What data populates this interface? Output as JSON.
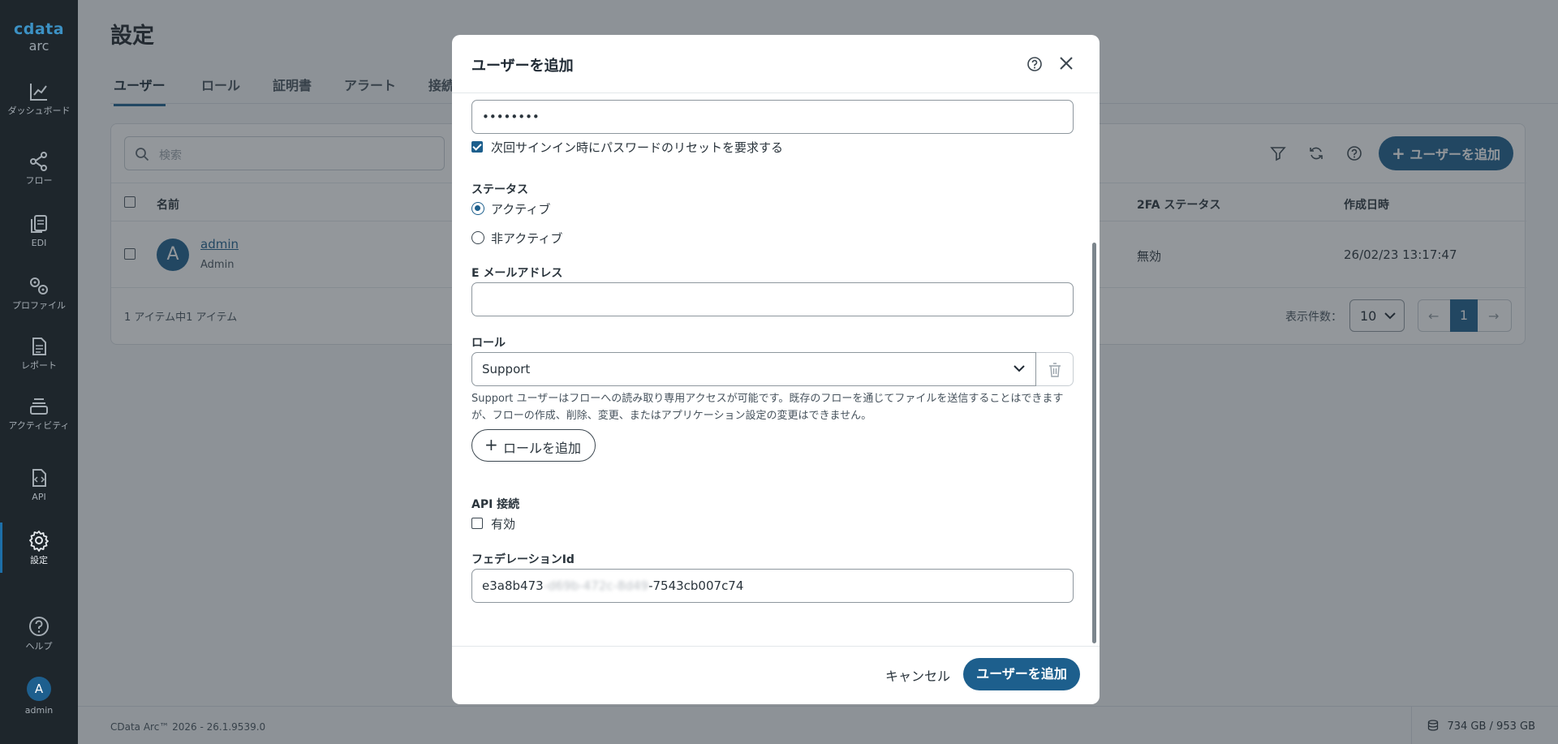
{
  "sidebar": {
    "logo_top": "cdata",
    "logo_bottom": "arc",
    "items": [
      {
        "label": "ダッシュボード",
        "icon": "chart-line-icon"
      },
      {
        "label": "フロー",
        "icon": "share-nodes-icon"
      },
      {
        "label": "EDI",
        "icon": "documents-icon"
      },
      {
        "label": "プロファイル",
        "icon": "gears-icon"
      },
      {
        "label": "レポート",
        "icon": "report-icon"
      },
      {
        "label": "アクティビティ",
        "icon": "layers-icon"
      },
      {
        "label": "API",
        "icon": "api-file-icon"
      },
      {
        "label": "設定",
        "icon": "gear-icon",
        "active": true
      },
      {
        "label": "ヘルプ",
        "icon": "help-icon"
      }
    ],
    "user_initial": "A",
    "user_label": "admin"
  },
  "page": {
    "title": "設定",
    "tabs": [
      "ユーザー",
      "ロール",
      "証明書",
      "アラート",
      "接続"
    ],
    "search_placeholder": "検索",
    "add_user_label": "ユーザーを追加",
    "columns": [
      "名前",
      "2FA ステータス",
      "作成日時"
    ],
    "row": {
      "initial": "A",
      "name": "admin",
      "role": "Admin",
      "twofa": "無効",
      "created": "26/02/23 13:17:47"
    },
    "item_count": "1 アイテム中1 アイテム",
    "per_page_label": "表示件数：",
    "per_page_value": "10",
    "current_page": "1"
  },
  "status_bar": {
    "version": "CData Arc™ 2026 - 26.1.9539.0",
    "disk": "734 GB / 953 GB"
  },
  "modal": {
    "title": "ユーザーを追加",
    "password_value": "••••••••",
    "reset_checkbox_label": "次回サインイン時にパスワードのリセットを要求する",
    "reset_checked": true,
    "status_label": "ステータス",
    "status_options": [
      "アクティブ",
      "非アクティブ"
    ],
    "status_selected": "アクティブ",
    "email_label": "E メールアドレス",
    "email_value": "",
    "role_label": "ロール",
    "role_value": "Support",
    "role_help": "Support ユーザーはフローへの読み取り専用アクセスが可能です。既存のフローを通じてファイルを送信することはできますが、フローの作成、削除、変更、またはアプリケーション設定の変更はできません。",
    "add_role_label": "ロールを追加",
    "api_label": "API 接続",
    "api_checkbox_label": "有効",
    "api_enabled": false,
    "federation_label": "フェデレーションId",
    "federation_prefix": "e3a8b473",
    "federation_hidden": "-d69b-472c-8d49",
    "federation_suffix": "-7543cb007c74",
    "cancel_label": "キャンセル",
    "submit_label": "ユーザーを追加"
  }
}
